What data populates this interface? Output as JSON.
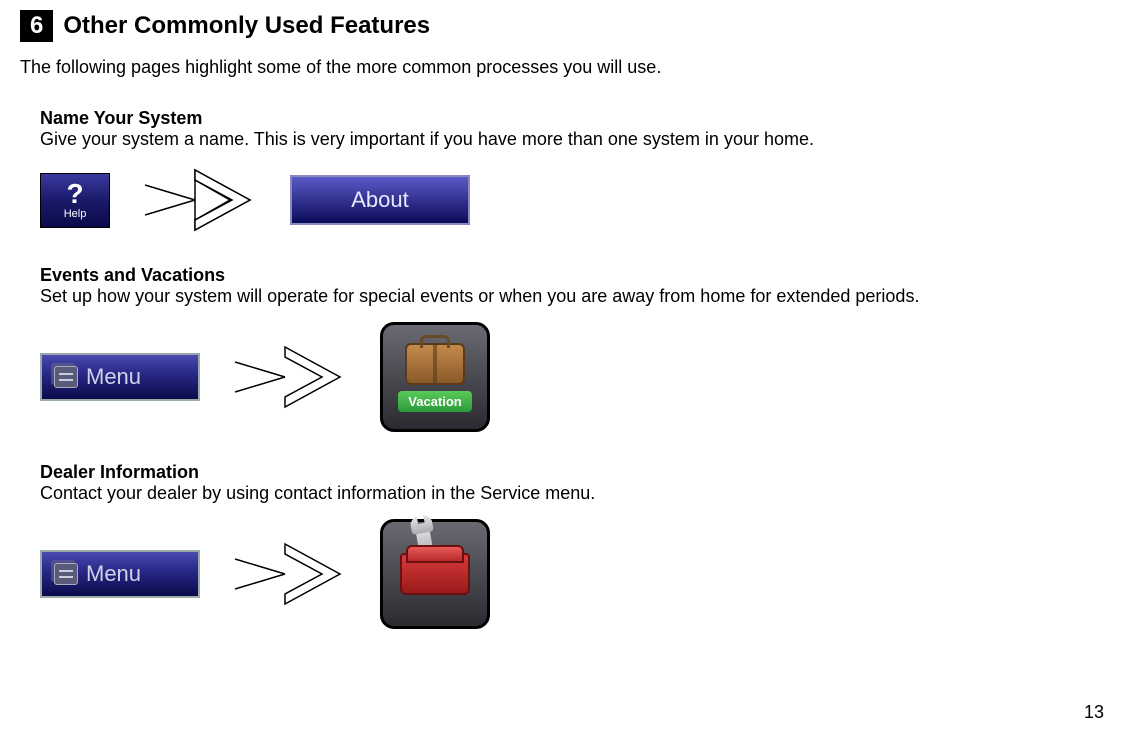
{
  "section": {
    "number": "6",
    "title": "Other Commonly Used Features"
  },
  "intro": "The following pages highlight some of the more common processes you will use.",
  "features": [
    {
      "title": "Name Your System",
      "desc": "Give your system a name. This is very important if you have more than one system in your home.",
      "help_symbol": "?",
      "help_label": "Help",
      "target_label": "About"
    },
    {
      "title": "Events and Vacations",
      "desc": "Set up how your system will operate for special events or when you are away from home for extended periods.",
      "menu_label": "Menu",
      "icon_label": "Vacation"
    },
    {
      "title": "Dealer Information",
      "desc": "Contact your dealer by using contact information in the Service menu.",
      "menu_label": "Menu"
    }
  ],
  "page_number": "13"
}
